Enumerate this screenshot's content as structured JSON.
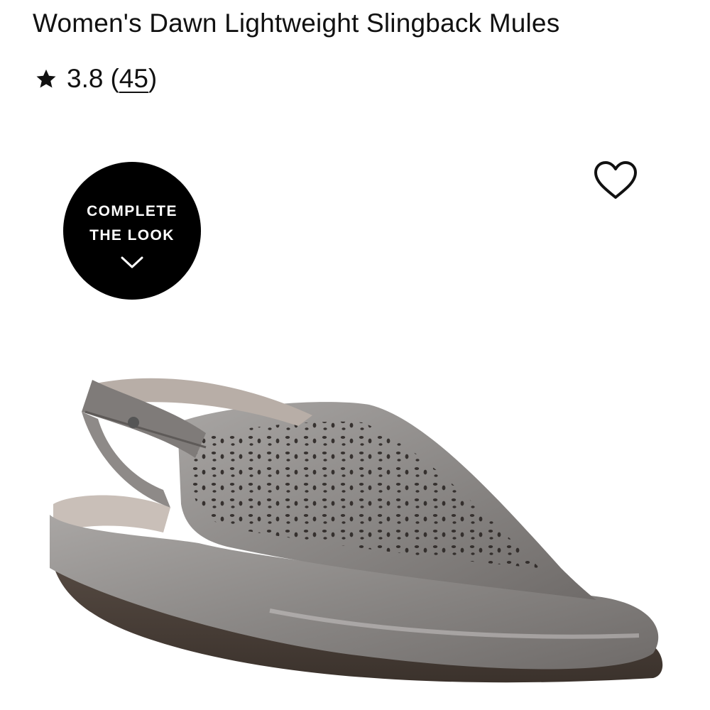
{
  "product": {
    "title": "Women's Dawn Lightweight Slingback Mules",
    "rating": {
      "value": "3.8",
      "open": "(",
      "count": "45",
      "close": ")",
      "star_icon": "star-icon"
    }
  },
  "wishlist": {
    "icon": "heart-icon"
  },
  "complete_the_look": {
    "line1": "COMPLETE",
    "line2": "THE LOOK",
    "icon": "chevron-down-icon"
  },
  "image": {
    "subject": "metallic pewter slingback mule shoe with floral perforations",
    "colors": {
      "upper": "#8d8a88",
      "sole": "#4a3f38",
      "lining": "#c9bfb8"
    }
  }
}
